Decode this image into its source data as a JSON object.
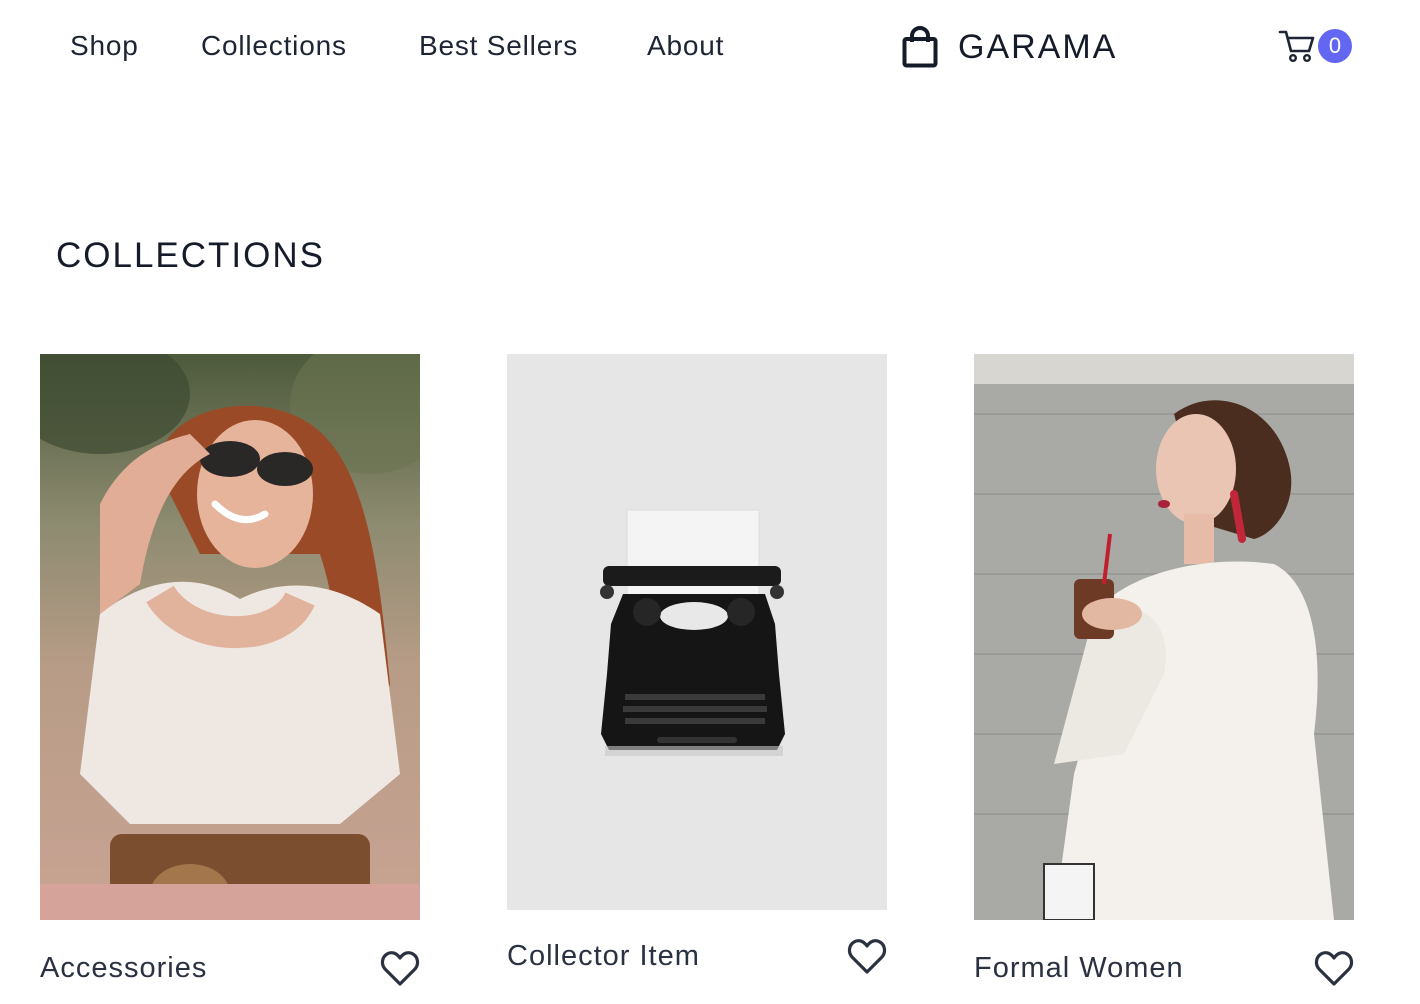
{
  "nav": {
    "links": [
      "Shop",
      "Collections",
      "Best Sellers",
      "About"
    ],
    "brand": "GARAMA",
    "brand_icon": "shopping-bag-icon",
    "cart_icon": "cart-icon",
    "cart_count": "0"
  },
  "colors": {
    "text": "#1d2433",
    "accent": "#6366f1",
    "background": "#ffffff"
  },
  "main": {
    "title": "COLLECTIONS",
    "collections": [
      {
        "label": "Accessories",
        "icon": "heart-icon"
      },
      {
        "label": "Collector Item",
        "icon": "heart-icon"
      },
      {
        "label": "Formal Women",
        "icon": "heart-icon"
      }
    ]
  }
}
